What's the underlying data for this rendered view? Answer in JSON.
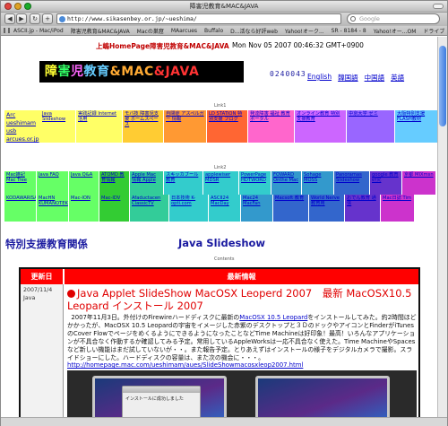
{
  "window": {
    "title": "障害児教育&MAC&JAVA"
  },
  "toolbar": {
    "url": "http://www.sikasenbey.or.jp/~ueshima/",
    "search_placeholder": "Google"
  },
  "bookmarks": [
    "ASCII.jp - Mac/iPod",
    "障害児教育&MAC&JAVA",
    "Macの巣窟",
    "MAarcues",
    "Buffalo",
    "D...活なら好評web",
    "Yahoo!オーク...",
    "SR - 8184 - 8",
    "Yahoo!オー...OM",
    "ドライブ"
  ],
  "header": {
    "title": "上嶋HomePage障害児教育&MAC&JAVA",
    "datetime": "Mon Nov 05 2007 00:46:32 GMT+0900",
    "banner_chars": [
      "障",
      "害",
      "児",
      "教育",
      "&MAC",
      "&JAVA"
    ],
    "counter": "0240043",
    "languages": [
      "English",
      "韓国語",
      "中国語",
      "英語"
    ]
  },
  "link1": {
    "label": "Link1",
    "cells": [
      {
        "text": "Java Slideshow",
        "color": "#ffff66"
      },
      {
        "text": "実践記録 Internet活用",
        "color": "#ffff66"
      },
      {
        "text": "モバ技 障害児支援 ホームスペース",
        "color": "#ffcc33"
      },
      {
        "text": "自閉症 アスペルガー 情報",
        "color": "#ff9933"
      },
      {
        "text": "LD STATION 特別支援 ブログ",
        "color": "#ff6633"
      },
      {
        "text": "発達障害 福祉 教育 ポータル",
        "color": "#ff66cc"
      },
      {
        "text": "オンライン教育 特別支援教育",
        "color": "#cc66ff"
      },
      {
        "text": "中京大学 ゼミ",
        "color": "#9966ff"
      },
      {
        "text": "大阪特別支援 FLASH教材",
        "color": "#66ccff"
      }
    ]
  },
  "link1_big": {
    "cells": [
      "Arc",
      "ueshimam",
      "usb",
      "arcues.or.jp"
    ]
  },
  "link2": {
    "label": "Link2",
    "row1": [
      {
        "text": "Mac雑記 Mac Tree",
        "color": "#66ff66"
      },
      {
        "text": "Java FAQ",
        "color": "#66ff66"
      },
      {
        "text": "Java Q&A",
        "color": "#66ff66"
      },
      {
        "text": "ATOMD 教育情報",
        "color": "#33cc33"
      },
      {
        "text": "Apple Mac 情報 Apple",
        "color": "#33cc99"
      },
      {
        "text": "スキッカブール 教育",
        "color": "#33cccc"
      },
      {
        "text": "applewiser MDSR",
        "color": "#33cccc"
      },
      {
        "text": "PowerPage HDTWORD",
        "color": "#33cccc"
      },
      {
        "text": "FOWARD Onthe Mac",
        "color": "#3399cc"
      },
      {
        "text": "Sohage MOSS",
        "color": "#3399cc"
      },
      {
        "text": "Panoramas Slideshow",
        "color": "#3366cc"
      },
      {
        "text": "google 教育研究",
        "color": "#6633cc"
      },
      {
        "text": "京都 MIXmsn",
        "color": "#cc33cc"
      }
    ],
    "row2": [
      {
        "text": "KODAWARISAN",
        "color": "#66ff66"
      },
      {
        "text": "MacHN KUMANOTEK",
        "color": "#66ff66"
      },
      {
        "text": "Mac-ION",
        "color": "#66ff66"
      },
      {
        "text": "Mac-IDV",
        "color": "#33cc33"
      },
      {
        "text": "Afaductacen ClassicTV",
        "color": "#33cc99"
      },
      {
        "text": "日本技術 K-opti.com",
        "color": "#33cccc"
      },
      {
        "text": "ASCII24 MacDay",
        "color": "#33cccc"
      },
      {
        "text": "Mac24 MacFan",
        "color": "#3399cc"
      },
      {
        "text": "Macsoft 教育",
        "color": "#3366cc"
      },
      {
        "text": "World Nerve 教育用",
        "color": "#3366cc"
      },
      {
        "text": "おでん教育 通信",
        "color": "#6633cc"
      },
      {
        "text": "Mac日誌 Tim",
        "color": "#cc33cc"
      }
    ]
  },
  "section": {
    "title": "特別支援教育関係",
    "subtitle": "Java Slideshow",
    "contents_label": "Contents"
  },
  "table": {
    "col_date": "更新日",
    "col_news": "最新情報",
    "date": "2007/11/4",
    "date2": "Java",
    "article_title": "Java Applet SlideShow MacOSX Leoperd 2007　最新 MacOSX10.5 Leopard インストール 2007",
    "article_body_1": "2007年11月3日。外付けのFirewireハードディスクに最新の",
    "article_body_link": "MacOSX 10.5 Leopard",
    "article_body_2": "をインストールしてみた。約2時間ほどかかったが、MacOSX 10.5 Leopardの宇宙をイメージした赤紫のデスクトップと３ＤのドックやアイコンとFinderがiTunesのCover FlowでページをめくるようにできるようになったことなどTime Machineは好印象！最高！いろんなアプリケーションが不具合なく作動するか確認してみる予定。常用しているAppleWorksは一応不具合なく使えた。Time MachineやSpacesなど新しい機能はまだ試していないが・・。また報告予定。とりあえずはインストールの様子をデジタルカメラで撮影。スライドショーにした。ハードディスクの容量は、また次の機会に・・・。",
    "article_url": "http://homepage.mac.com/ueshimam/aues/SlideShowmacosxleop2007.html",
    "dialog_text": "インストールに成功しました"
  }
}
